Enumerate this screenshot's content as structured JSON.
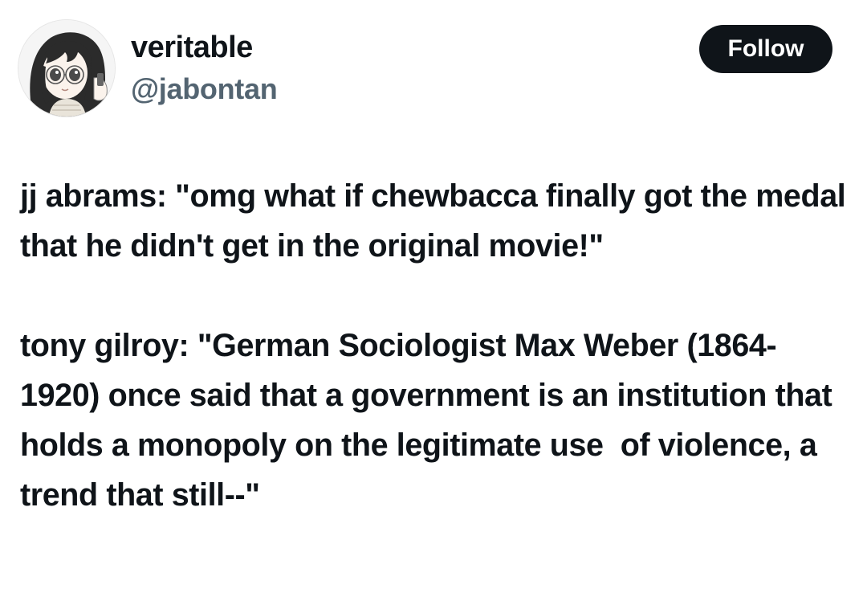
{
  "author": {
    "display_name": "veritable",
    "handle": "@jabontan",
    "avatar_icon": "anime-girl-avatar-icon"
  },
  "follow_button": {
    "label": "Follow"
  },
  "tweet": {
    "paragraphs": [
      "jj abrams: \"omg what if chewbacca finally got the medal that he didn't get in the original movie!\"",
      "tony gilroy: \"German Sociologist Max Weber (1864-1920) once said that a government is an institution that holds a monopoly on the legitimate use  of violence, a trend that still--\""
    ]
  },
  "colors": {
    "text_primary": "#0f1419",
    "text_secondary": "#536471",
    "button_bg": "#0f1419",
    "button_text": "#ffffff",
    "background": "#ffffff"
  }
}
